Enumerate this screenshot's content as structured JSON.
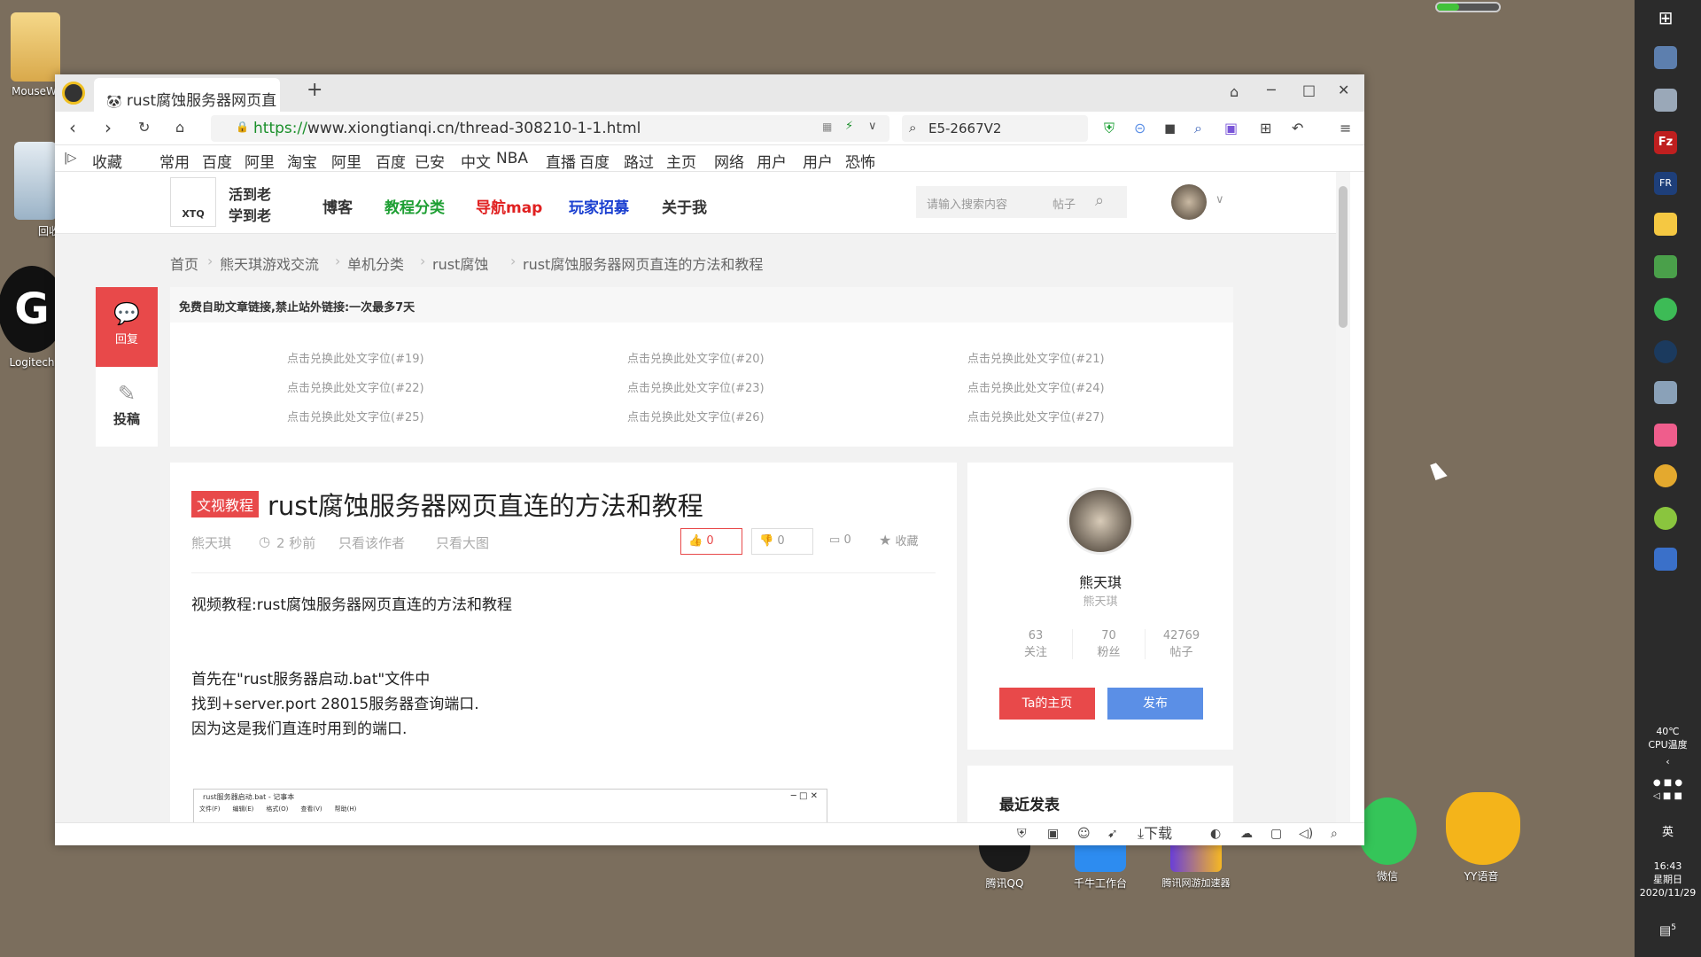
{
  "desktop": {
    "icons": [
      {
        "label": "MouseWi",
        "color": "#e7c36a"
      },
      {
        "label": "回收",
        "color": "#9bb3c7"
      },
      {
        "label": "Logitech",
        "color": "#111111"
      },
      {
        "label": "腾讯QQ",
        "color": "#1a1a1a"
      },
      {
        "label": "千牛工作台",
        "color": "#2d8cf0"
      },
      {
        "label": "腾讯网游加速器",
        "color": "#6a3fd8"
      },
      {
        "label": "微信",
        "color": "#35c559"
      },
      {
        "label": "YY语音",
        "color": "#f4b41a"
      }
    ]
  },
  "taskbar": {
    "cpu_temp": "40℃",
    "cpu_label": "CPU温度",
    "ime": "英",
    "time": "16:43",
    "weekday": "星期日",
    "date": "2020/11/29",
    "notif_count": "5"
  },
  "browser": {
    "tab_title": "rust腐蚀服务器网页直",
    "new_tab": "+",
    "url_scheme": "https://",
    "url_rest": "www.xiongtianqi.cn/thread-308210-1-1.html",
    "search_value": "E5-2667V2",
    "bookmarks": [
      "收藏",
      "常用",
      "百度",
      "阿里",
      "淘宝",
      "阿里",
      "百度",
      "已安",
      "中文",
      "NBA",
      "直播",
      "百度",
      "路过",
      "主页",
      "网络",
      "用户",
      "用户",
      "恐怖"
    ],
    "status_download": "下载"
  },
  "site": {
    "logo_line1": "活到老",
    "logo_line2": "学到老",
    "logo_mark": "XTQ",
    "nav": [
      {
        "label": "博客",
        "color": "#333333"
      },
      {
        "label": "教程分类",
        "color": "#1e9f33"
      },
      {
        "label": "导航map",
        "color": "#e02020"
      },
      {
        "label": "玩家招募",
        "color": "#1a3fd0"
      },
      {
        "label": "关于我",
        "color": "#333333"
      }
    ],
    "search_placeholder": "请输入搜索内容",
    "search_type": "帖子",
    "breadcrumb": [
      "首页",
      "熊天琪游戏交流",
      "单机分类",
      "rust腐蚀",
      "rust腐蚀服务器网页直连的方法和教程"
    ],
    "side": {
      "reply": "回复",
      "post": "投稿"
    },
    "ad_title": "免费自助文章链接,禁止站外链接:一次最多7天",
    "ad_links": [
      "点击兑换此处文字位(#19)",
      "点击兑换此处文字位(#20)",
      "点击兑换此处文字位(#21)",
      "点击兑换此处文字位(#22)",
      "点击兑换此处文字位(#23)",
      "点击兑换此处文字位(#24)",
      "点击兑换此处文字位(#25)",
      "点击兑换此处文字位(#26)",
      "点击兑换此处文字位(#27)"
    ],
    "article": {
      "tag": "文视教程",
      "title": "rust腐蚀服务器网页直连的方法和教程",
      "author": "熊天琪",
      "time": "2 秒前",
      "only_author": "只看该作者",
      "only_big": "只看大图",
      "likes": "0",
      "dislikes": "0",
      "comments": "0",
      "fav": "收藏",
      "body": [
        "视频教程:rust腐蚀服务器网页直连的方法和教程",
        "首先在\"rust服务器启动.bat\"文件中",
        "找到+server.port 28015服务器查询端口.",
        "因为这是我们直连时用到的端口."
      ],
      "notepad_title": "rust服务器启动.bat - 记事本",
      "notepad_menu": [
        "文件(F)",
        "编辑(E)",
        "格式(O)",
        "查看(V)",
        "帮助(H)"
      ]
    },
    "profile": {
      "name": "熊天琪",
      "sub": "熊天琪",
      "stats": [
        {
          "num": "63",
          "label": "关注"
        },
        {
          "num": "70",
          "label": "粉丝"
        },
        {
          "num": "42769",
          "label": "帖子"
        }
      ],
      "home_btn": "Ta的主页",
      "publish_btn": "发布",
      "recent": "最近发表"
    }
  },
  "colors": {
    "accent_red": "#e8494a",
    "accent_blue": "#5b8fe6"
  }
}
